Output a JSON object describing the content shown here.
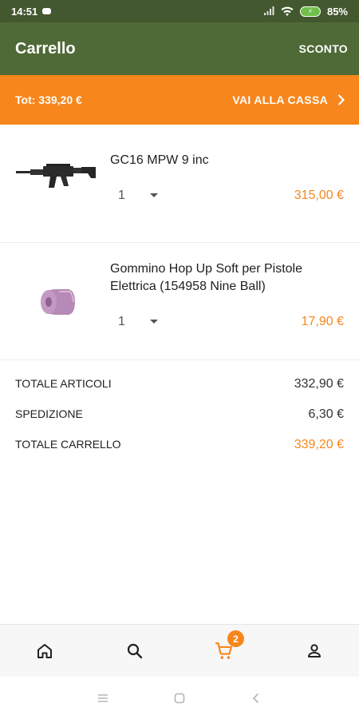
{
  "status_bar": {
    "time": "14:51",
    "battery": "85%"
  },
  "app_bar": {
    "title": "Carrello",
    "action": "SCONTO"
  },
  "checkout": {
    "total": "Tot: 339,20 €",
    "button": "VAI ALLA CASSA"
  },
  "items": [
    {
      "name": "GC16 MPW 9 inc",
      "quantity": "1",
      "price": "315,00 €",
      "thumb_icon": "rifle-image"
    },
    {
      "name": "Gommino Hop Up Soft per Pistole Elettrica (154958 Nine Ball)",
      "quantity": "1",
      "price": "17,90 €",
      "thumb_icon": "hop-up-rubber-image"
    }
  ],
  "summary": {
    "articles_label": "TOTALE ARTICOLI",
    "articles_value": "332,90 €",
    "shipping_label": "SPEDIZIONE",
    "shipping_value": "6,30 €",
    "cart_label": "TOTALE CARRELLO",
    "cart_value": "339,20 €"
  },
  "bottom_nav": {
    "cart_badge": "2",
    "icons": [
      "home-icon",
      "search-icon",
      "cart-icon",
      "profile-icon"
    ]
  },
  "colors": {
    "primary": "#4f6a37",
    "status_bar": "#43582f",
    "accent": "#f7861d"
  }
}
